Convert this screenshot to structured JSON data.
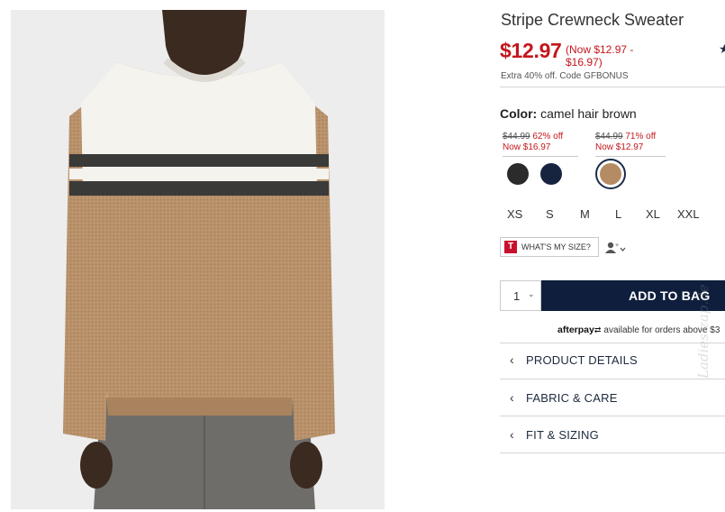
{
  "product": {
    "title": "Stripe Crewneck Sweater",
    "star_icon": "star-icon",
    "price": "$12.97",
    "price_range_line1": "(Now $12.97 -",
    "price_range_line2": "$16.97)",
    "promo": "Extra 40% off. Code GFBONUS"
  },
  "color": {
    "label": "Color:",
    "value": "camel hair brown",
    "price_groups": [
      {
        "original": "$44.99",
        "discount": "62% off",
        "now": "Now $16.97"
      },
      {
        "original": "$44.99",
        "discount": "71% off",
        "now": "Now $12.97"
      }
    ],
    "swatches": [
      {
        "name": "charcoal",
        "color": "#2b2b2b"
      },
      {
        "name": "navy",
        "color": "#172440"
      },
      {
        "name": "camel hair brown",
        "color": "#b58b63",
        "selected": true
      }
    ]
  },
  "sizes": [
    "XS",
    "S",
    "M",
    "L",
    "XL",
    "XXL"
  ],
  "fit": {
    "logo_letter": "T",
    "label": "WHAT'S MY SIZE?",
    "profile_icon": "profile-icon"
  },
  "purchase": {
    "quantity": "1",
    "add_to_bag": "ADD TO BAG"
  },
  "afterpay": {
    "logo": "afterpay",
    "text": "available for orders above $3"
  },
  "accordions": [
    {
      "label": "PRODUCT DETAILS"
    },
    {
      "label": "FABRIC & CARE"
    },
    {
      "label": "FIT & SIZING"
    }
  ],
  "watermark": "Ladies-zap.de",
  "colors": {
    "price_red": "#c4161c",
    "navy": "#0f1e3c"
  }
}
